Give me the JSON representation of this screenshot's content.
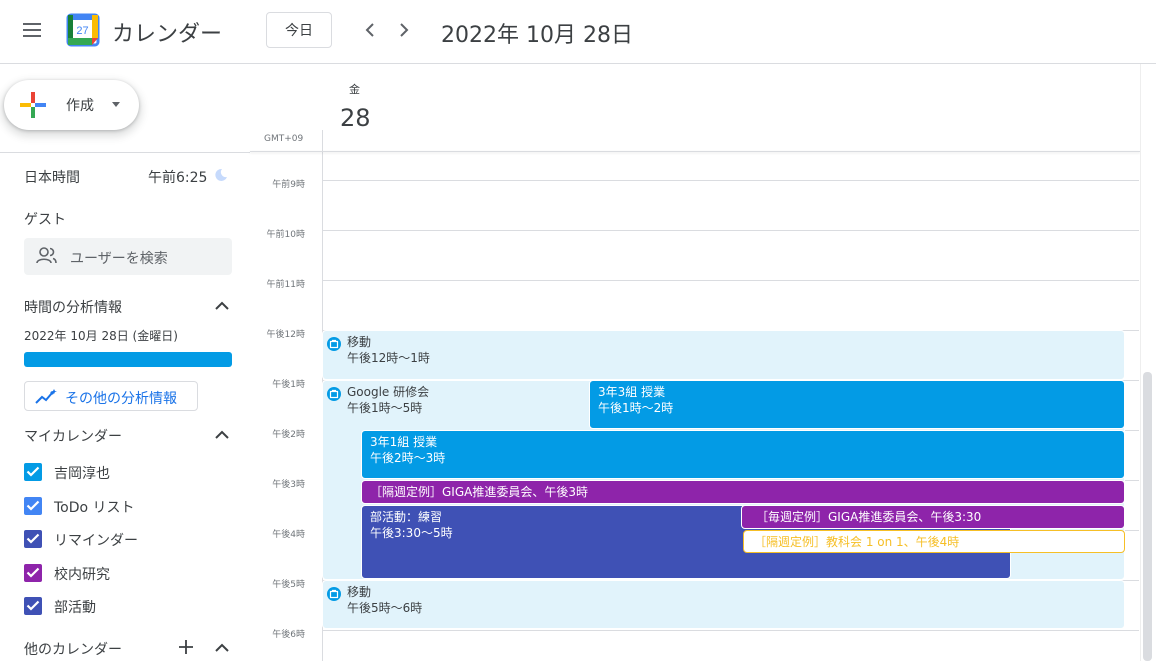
{
  "header": {
    "app_title": "カレンダー",
    "logo_day": "27",
    "today_label": "今日",
    "date_title": "2022年 10月 28日"
  },
  "sidebar": {
    "create_label": "作成",
    "timezone_label": "日本時間",
    "timezone_time": "午前6:25",
    "guest_label": "ゲスト",
    "search_placeholder": "ユーザーを検索",
    "analysis_title": "時間の分析情報",
    "analysis_date": "2022年 10月 28日 (金曜日)",
    "more_analysis_label": "その他の分析情報",
    "my_calendars_title": "マイカレンダー",
    "my_calendars": [
      {
        "name": "吉岡淳也",
        "color": "#039be5"
      },
      {
        "name": "ToDo リスト",
        "color": "#4285f4"
      },
      {
        "name": "リマインダー",
        "color": "#3f51b5"
      },
      {
        "name": "校内研究",
        "color": "#8e24aa"
      },
      {
        "name": "部活動",
        "color": "#3f51b5"
      }
    ],
    "other_calendars_title": "他のカレンダー"
  },
  "grid": {
    "day_name": "金",
    "day_number": "28",
    "timezone": "GMT+09",
    "hours": [
      "午前9時",
      "午前10時",
      "午前11時",
      "午後12時",
      "午後1時",
      "午後2時",
      "午後3時",
      "午後4時",
      "午後5時",
      "午後6時"
    ]
  },
  "events": [
    {
      "title": "移動",
      "time": "午後12時～1時"
    },
    {
      "title": "Google 研修会",
      "time": "午後1時～5時"
    },
    {
      "title": "3年3組 授業",
      "time": "午後1時～2時"
    },
    {
      "title": "3年1組 授業",
      "time": "午後2時～3時"
    },
    {
      "title": "［隔週定例］GIGA推進委員会、午後3時"
    },
    {
      "title": "部活動：練習",
      "time": "午後3:30～5時"
    },
    {
      "title": "［毎週定例］GIGA推進委員会、午後3:30"
    },
    {
      "title": "［隔週定例］教科会 1 on 1、午後4時"
    },
    {
      "title": "移動",
      "time": "午後5時～6時"
    }
  ],
  "colors": {
    "blue": "#039be5",
    "purple": "#8e24aa",
    "indigo": "#3f51b5",
    "out_of_office_bg": "#e1f3fb",
    "banana": "#f6bf26",
    "link": "#1a73e8"
  }
}
